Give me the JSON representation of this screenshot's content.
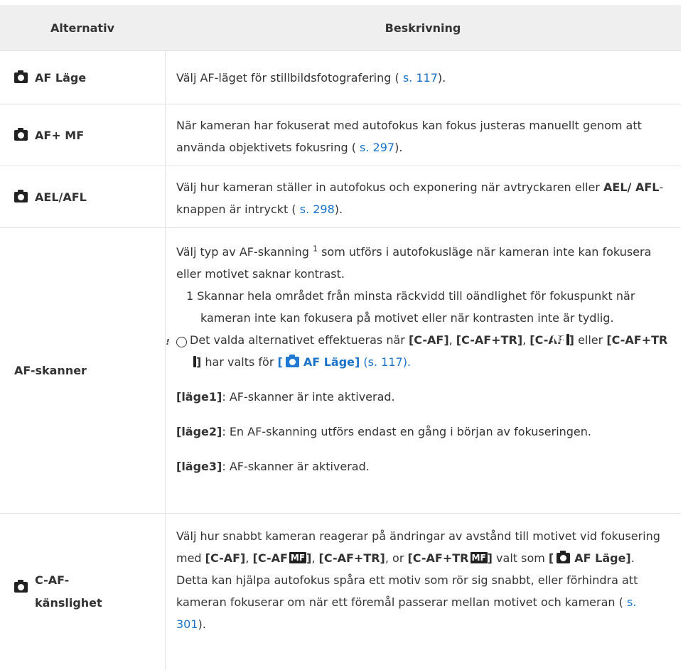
{
  "headers": {
    "option": "Alternativ",
    "description": "Beskrivning"
  },
  "rows": {
    "af_mode": {
      "label": "AF Läge",
      "desc_pre": "Välj AF-läget för stillbildsfotografering (",
      "ref": "s. 117",
      "desc_post": ")."
    },
    "af_mf": {
      "label": "AF+ MF",
      "desc_pre": "När kameran har fokuserat med autofokus kan fokus justeras manuellt genom att använda objektivets fokusring (",
      "ref": "s. 297",
      "desc_post": ")."
    },
    "ael_afl": {
      "label": "AEL/AFL",
      "desc_pre": "Välj hur kameran ställer in autofokus och exponering när avtryckaren eller ",
      "bold": "AEL/ AFL",
      "desc_mid": "-knappen är intryckt (",
      "ref": "s. 298",
      "desc_post": ")."
    },
    "af_scanner": {
      "label": "AF-skanner",
      "intro_pre": "Välj typ av AF-skanning ",
      "intro_sup": "1",
      "intro_post": " som utförs i autofokusläge när kameran inte kan fokusera eller motivet saknar kontrast.",
      "footnote": "1 Skannar hela området från minsta räckvidd till oändlighet för fokuspunkt när kameran inte kan fokusera på motivet eller när kontrasten inte är tydlig.",
      "note_pre": "Det valda alternativet effektueras när ",
      "note_caf": "[C-AF]",
      "note_sep1": ", ",
      "note_caftr": "[C-AF+TR]",
      "note_sep2": ", ",
      "note_cafmf": "[C-AF",
      "mf_badge": "MF",
      "note_close": "]",
      "note_or": " eller ",
      "note_caftrmf": "[C-AF+TR",
      "note_has": " har valts för ",
      "note_link_open": "[",
      "note_link_label": "AF Läge]",
      "note_ref": "(s. 117).",
      "mode1_key": "[läge1]",
      "mode1_text": ": AF-skanner är inte aktiverad.",
      "mode2_key": "[läge2]",
      "mode2_text": ": En AF-skanning utförs endast en gång i början av fokuseringen.",
      "mode3_key": "[läge3]",
      "mode3_text": ": AF-skanner är aktiverad."
    },
    "caf_sens": {
      "label_line1": "C-AF-",
      "label_line2": "känslighet",
      "t1": "Välj hur snabbt kameran reagerar på ändringar av avstånd till motivet vid fokusering med ",
      "b1": "[C-AF]",
      "s1": ", ",
      "b2": "[C-AF",
      "b2c": "]",
      "s2": ", ",
      "b3": "[C-AF+TR]",
      "s3": ", or ",
      "b4": "[C-AF+TR",
      "b4c": "]",
      "t2": " valt som ",
      "b5_open": "[",
      "b5": "AF Läge]",
      "t3": ". Detta kan hjälpa autofokus spåra ett motiv som rör sig snabbt, eller förhindra att kameran fokuserar om när ett föremål passerar mellan motivet och kameran (",
      "ref": "s. 301",
      "desc_post": ")."
    }
  },
  "colors": {
    "header_bg": "#efefef",
    "link": "#1a73c8",
    "text": "#333333"
  }
}
